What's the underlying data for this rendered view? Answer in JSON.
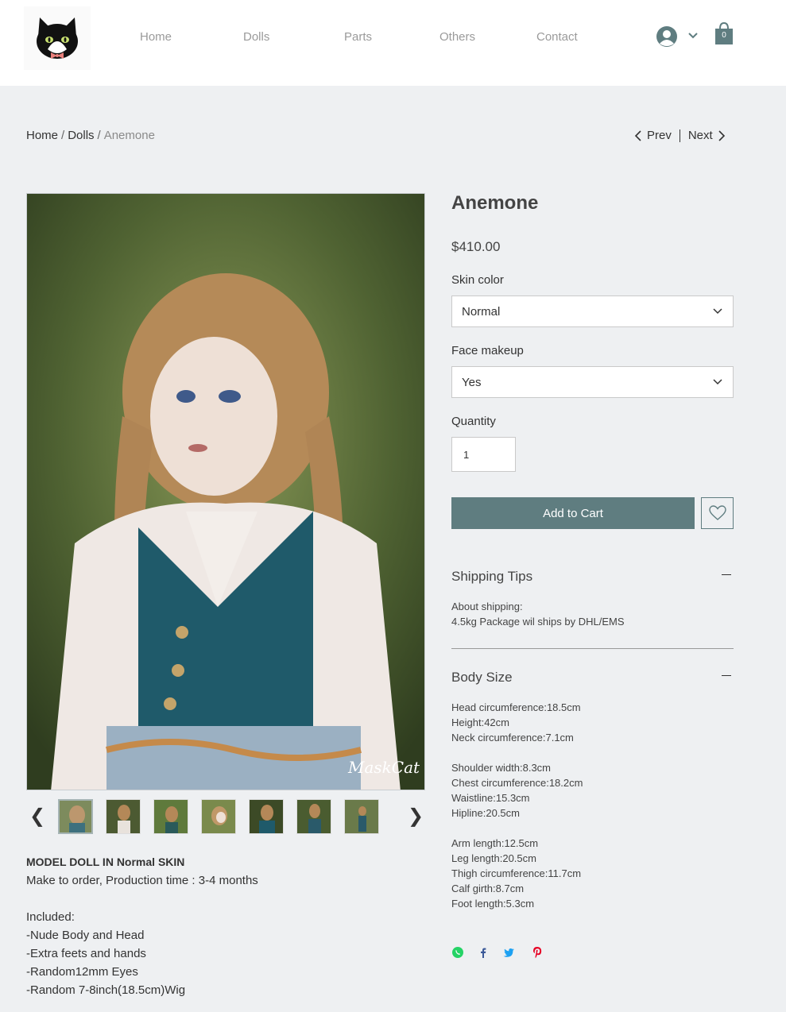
{
  "nav": {
    "items": [
      "Home",
      "Dolls",
      "Parts",
      "Others",
      "Contact"
    ],
    "cart_count": "0"
  },
  "breadcrumb": {
    "home": "Home",
    "category": "Dolls",
    "current": "Anemone",
    "separator": "/"
  },
  "pager": {
    "prev": "Prev",
    "next": "Next"
  },
  "gallery": {
    "watermark": "MaskCat",
    "thumb_count": 7
  },
  "description": {
    "heading": "MODEL DOLL IN Normal SKIN",
    "lines": [
      "Make to order, Production time : 3-4 months",
      "",
      "Included:",
      "-Nude Body and Head",
      "-Extra feets and hands",
      "-Random12mm Eyes",
      "-Random 7-8inch(18.5cm)Wig"
    ]
  },
  "product": {
    "title": "Anemone",
    "price": "$410.00",
    "skin_label": "Skin color",
    "skin_value": "Normal",
    "face_label": "Face makeup",
    "face_value": "Yes",
    "qty_label": "Quantity",
    "qty_value": "1",
    "add_to_cart": "Add to Cart"
  },
  "shipping": {
    "title": "Shipping Tips",
    "lines": [
      "About shipping:",
      "4.5kg Package wil ships by DHL/EMS"
    ]
  },
  "body_size": {
    "title": "Body Size",
    "lines": [
      "Head circumference:18.5cm",
      "Height:42cm",
      "Neck circumference:7.1cm",
      "",
      "Shoulder width:8.3cm",
      "Chest circumference:18.2cm",
      "Waistline:15.3cm",
      "Hipline:20.5cm",
      "",
      "Arm length:12.5cm",
      "Leg length:20.5cm",
      "Thigh circumference:11.7cm",
      "Calf girth:8.7cm",
      "Foot length:5.3cm"
    ]
  },
  "colors": {
    "accent": "#5f7d80",
    "whatsapp": "#25d366",
    "facebook": "#3b5998",
    "twitter": "#1da1f2",
    "pinterest": "#e60023"
  }
}
